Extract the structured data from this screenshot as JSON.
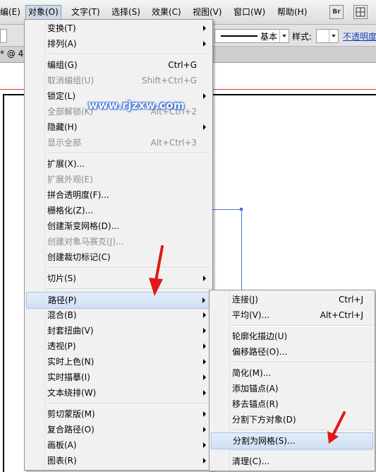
{
  "menubar": {
    "items": [
      "编(E)",
      "对象(O)",
      "文字(T)",
      "选择(S)",
      "效果(C)",
      "视图(V)",
      "窗口(W)",
      "帮助(H)"
    ],
    "br_label": "Br"
  },
  "controlbar": {
    "stroke_style": "基本",
    "style_label": "样式:",
    "opacity_label": "不透明度"
  },
  "tab": {
    "label": "* @ 4"
  },
  "watermark": "www.rjzxw.com",
  "object_menu": {
    "items": [
      {
        "label": "变换(T)",
        "shortcut": "",
        "submenu": true,
        "disabled": false
      },
      {
        "label": "排列(A)",
        "shortcut": "",
        "submenu": true,
        "disabled": false
      },
      {
        "label": "编组(G)",
        "shortcut": "Ctrl+G",
        "submenu": false,
        "disabled": false
      },
      {
        "label": "取消编组(U)",
        "shortcut": "Shift+Ctrl+G",
        "submenu": false,
        "disabled": true
      },
      {
        "label": "锁定(L)",
        "shortcut": "",
        "submenu": true,
        "disabled": false
      },
      {
        "label": "全部解锁(K)",
        "shortcut": "Alt+Ctrl+2",
        "submenu": false,
        "disabled": true
      },
      {
        "label": "隐藏(H)",
        "shortcut": "",
        "submenu": true,
        "disabled": false
      },
      {
        "label": "显示全部",
        "shortcut": "Alt+Ctrl+3",
        "submenu": false,
        "disabled": true
      },
      {
        "label": "扩展(X)...",
        "shortcut": "",
        "submenu": false,
        "disabled": false
      },
      {
        "label": "扩展外观(E)",
        "shortcut": "",
        "submenu": false,
        "disabled": true
      },
      {
        "label": "拼合透明度(F)...",
        "shortcut": "",
        "submenu": false,
        "disabled": false
      },
      {
        "label": "栅格化(Z)...",
        "shortcut": "",
        "submenu": false,
        "disabled": false
      },
      {
        "label": "创建渐变网格(D)...",
        "shortcut": "",
        "submenu": false,
        "disabled": false
      },
      {
        "label": "创建对象马赛克(J)...",
        "shortcut": "",
        "submenu": false,
        "disabled": true
      },
      {
        "label": "创建裁切标记(C)",
        "shortcut": "",
        "submenu": false,
        "disabled": false
      },
      {
        "label": "切片(S)",
        "shortcut": "",
        "submenu": true,
        "disabled": false
      },
      {
        "label": "路径(P)",
        "shortcut": "",
        "submenu": true,
        "disabled": false,
        "highlighted": true
      },
      {
        "label": "混合(B)",
        "shortcut": "",
        "submenu": true,
        "disabled": false
      },
      {
        "label": "封套扭曲(V)",
        "shortcut": "",
        "submenu": true,
        "disabled": false
      },
      {
        "label": "透视(P)",
        "shortcut": "",
        "submenu": true,
        "disabled": false
      },
      {
        "label": "实时上色(N)",
        "shortcut": "",
        "submenu": true,
        "disabled": false
      },
      {
        "label": "实时描摹(I)",
        "shortcut": "",
        "submenu": true,
        "disabled": false
      },
      {
        "label": "文本绕排(W)",
        "shortcut": "",
        "submenu": true,
        "disabled": false
      },
      {
        "label": "剪切蒙版(M)",
        "shortcut": "",
        "submenu": true,
        "disabled": false
      },
      {
        "label": "复合路径(O)",
        "shortcut": "",
        "submenu": true,
        "disabled": false
      },
      {
        "label": "画板(A)",
        "shortcut": "",
        "submenu": true,
        "disabled": false
      },
      {
        "label": "图表(R)",
        "shortcut": "",
        "submenu": true,
        "disabled": false
      }
    ]
  },
  "path_submenu": {
    "items": [
      {
        "label": "连接(J)",
        "shortcut": "Ctrl+J"
      },
      {
        "label": "平均(V)...",
        "shortcut": "Alt+Ctrl+J"
      },
      {
        "label": "轮廓化描边(U)",
        "shortcut": ""
      },
      {
        "label": "偏移路径(O)...",
        "shortcut": ""
      },
      {
        "label": "简化(M)...",
        "shortcut": ""
      },
      {
        "label": "添加锚点(A)",
        "shortcut": ""
      },
      {
        "label": "移去锚点(R)",
        "shortcut": ""
      },
      {
        "label": "分割下方对象(D)",
        "shortcut": ""
      },
      {
        "label": "分割为网格(S)...",
        "shortcut": "",
        "highlighted": true
      },
      {
        "label": "清理(C)...",
        "shortcut": ""
      }
    ]
  }
}
